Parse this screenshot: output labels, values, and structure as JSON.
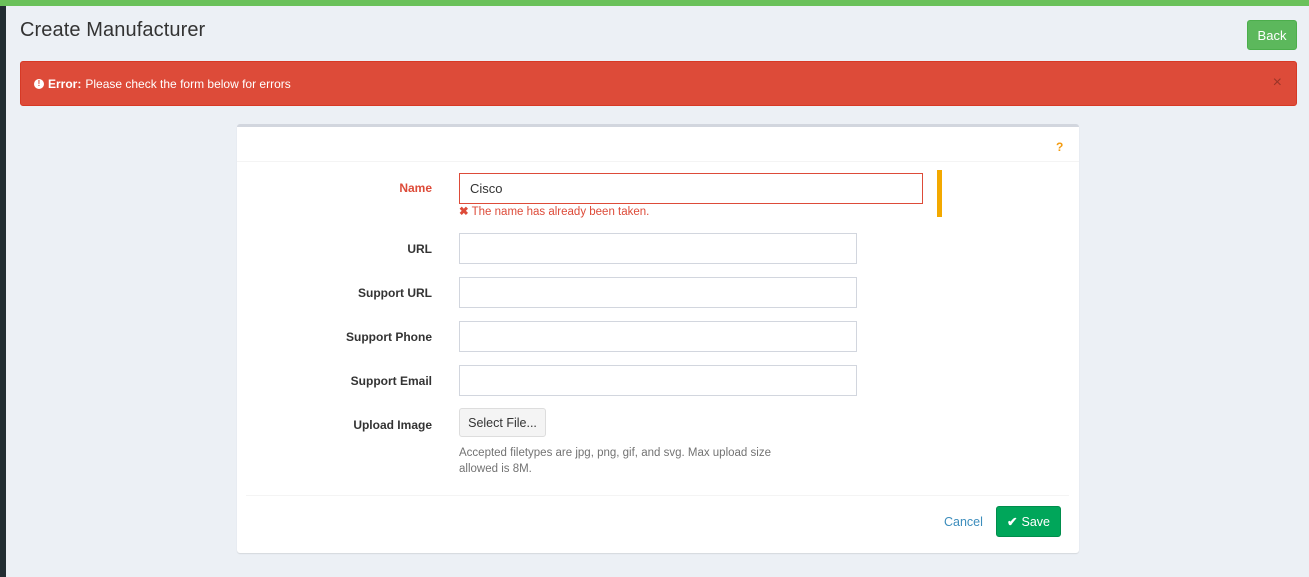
{
  "header": {
    "title": "Create Manufacturer",
    "back_label": "Back"
  },
  "alert": {
    "strong": "Error:",
    "message": "Please check the form below for errors",
    "close_glyph": "×",
    "icon_glyph": "!"
  },
  "form": {
    "help_glyph": "?",
    "name": {
      "label": "Name",
      "value": "Cisco",
      "error": "The name has already been taken.",
      "error_glyph": "✖"
    },
    "url": {
      "label": "URL",
      "value": ""
    },
    "support_url": {
      "label": "Support URL",
      "value": ""
    },
    "support_phone": {
      "label": "Support Phone",
      "value": ""
    },
    "support_email": {
      "label": "Support Email",
      "value": ""
    },
    "upload_image": {
      "label": "Upload Image",
      "button_label": "Select File...",
      "help": "Accepted filetypes are jpg, png, gif, and svg. Max upload size allowed is 8M."
    }
  },
  "footer": {
    "cancel_label": "Cancel",
    "save_label": "Save",
    "save_glyph": "✔"
  },
  "colors": {
    "top_strip": "#6ac15a",
    "error": "#dd4b39",
    "primary_success": "#00a65a",
    "back_button": "#5cb85c",
    "required_indicator": "#f3a900",
    "link": "#3c8dbc"
  },
  "icons": {
    "alert": "exclamation-circle-icon",
    "close": "close-icon",
    "help": "question-icon",
    "error": "times-icon",
    "save": "check-icon"
  }
}
